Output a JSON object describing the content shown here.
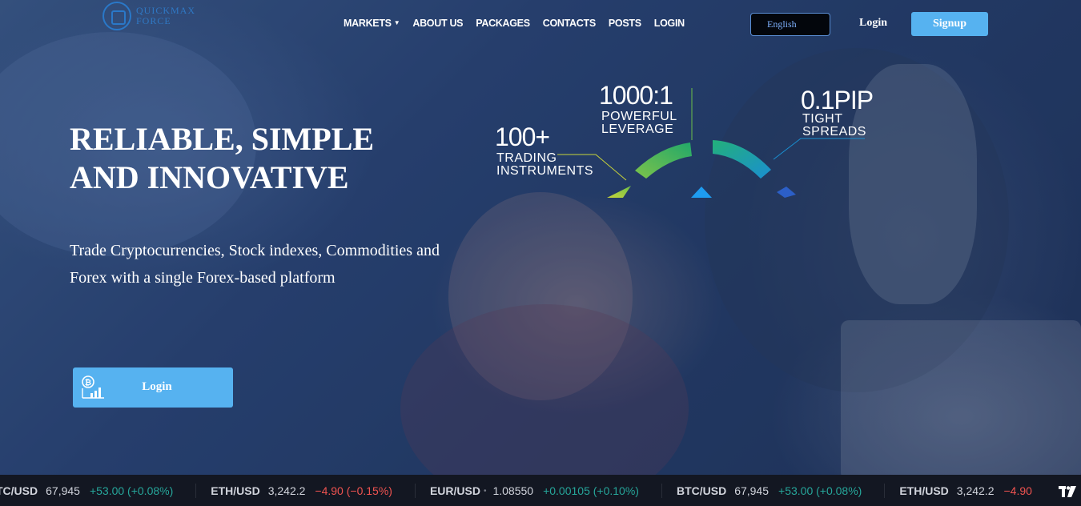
{
  "brand": {
    "logo_text_line1": "QUICKMAX",
    "logo_text_line2": "FORCE"
  },
  "nav": {
    "items": [
      {
        "label": "MARKETS",
        "has_dropdown": true
      },
      {
        "label": "ABOUT US"
      },
      {
        "label": "PACKAGES"
      },
      {
        "label": "CONTACTS"
      },
      {
        "label": "POSTS"
      },
      {
        "label": "LOGIN"
      }
    ],
    "language": "English",
    "login_label": "Login",
    "signup_label": "Signup"
  },
  "hero": {
    "headline_line1": "RELIABLE, SIMPLE",
    "headline_line2": "AND INNOVATIVE",
    "subtext": "Trade Cryptocurrencies, Stock indexes, Commodities and Forex with a single Forex-based platform",
    "cta_label": "Login"
  },
  "stats": {
    "instruments": {
      "value": "100+",
      "line1": "TRADING",
      "line2": "INSTRUMENTS"
    },
    "leverage": {
      "value": "1000:1",
      "line1": "POWERFUL",
      "line2": "LEVERAGE"
    },
    "spreads": {
      "value": "0.1PIP",
      "line1": "TIGHT",
      "line2": "SPREADS"
    }
  },
  "ticker": [
    {
      "symbol": "TC/USD",
      "price": "67,945",
      "change": "+53.00 (+0.08%)",
      "direction": "up"
    },
    {
      "symbol": "ETH/USD",
      "price": "3,242.2",
      "change": "−4.90 (−0.15%)",
      "direction": "down"
    },
    {
      "symbol": "EUR/USD",
      "price": "1.08550",
      "change": "+0.00105 (+0.10%)",
      "direction": "up"
    },
    {
      "symbol": "BTC/USD",
      "price": "67,945",
      "change": "+53.00 (+0.08%)",
      "direction": "up"
    },
    {
      "symbol": "ETH/USD",
      "price": "3,242.2",
      "change": "−4.90",
      "direction": "down"
    }
  ],
  "colors": {
    "accent": "#56b2f0",
    "up": "#26a69a",
    "down": "#ef5350",
    "ticker_bg": "#131722"
  }
}
